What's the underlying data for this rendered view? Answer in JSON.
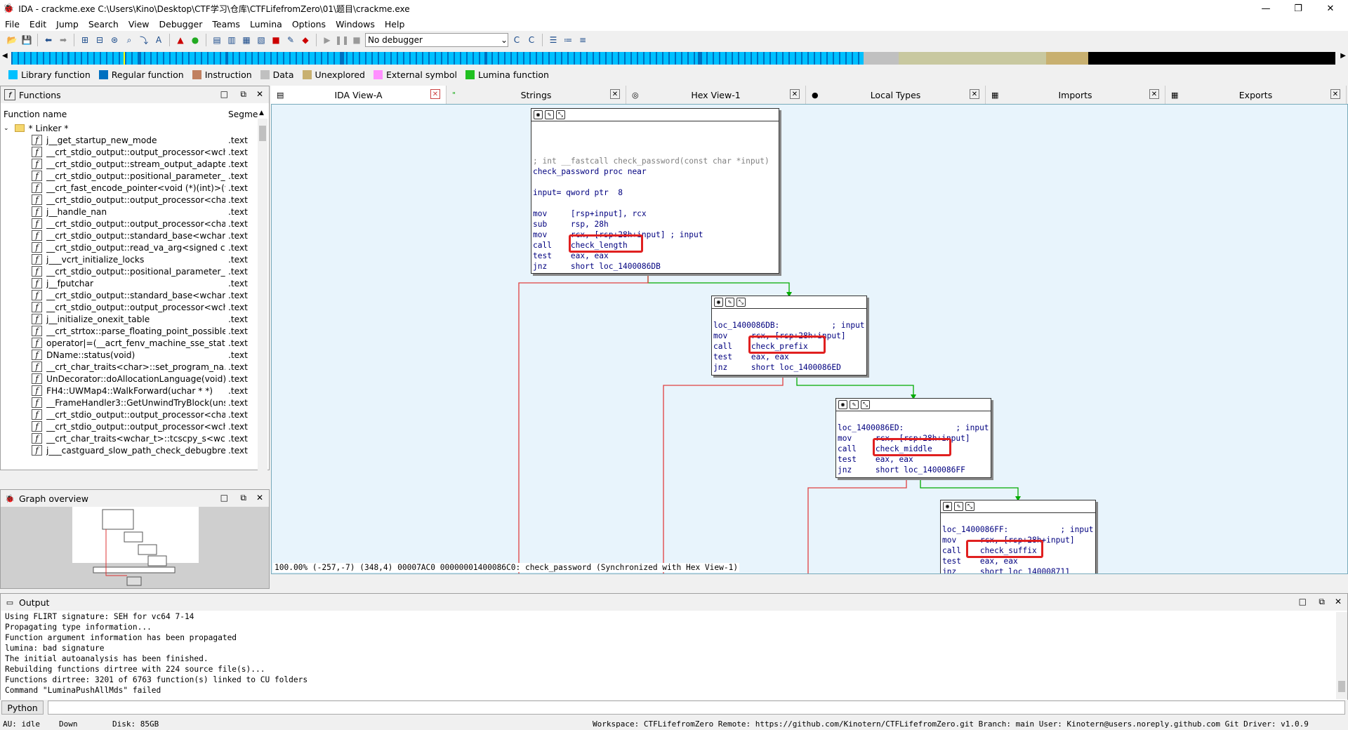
{
  "window": {
    "title": "IDA - crackme.exe C:\\Users\\Kino\\Desktop\\CTF学习\\仓库\\CTFLifefromZero\\01\\题目\\crackme.exe"
  },
  "menu": [
    "File",
    "Edit",
    "Jump",
    "Search",
    "View",
    "Debugger",
    "Teams",
    "Lumina",
    "Options",
    "Windows",
    "Help"
  ],
  "toolbar": {
    "debugger_select": "No debugger"
  },
  "legend": [
    {
      "label": "Library function",
      "color": "#00c0ff"
    },
    {
      "label": "Regular function",
      "color": "#0070c0"
    },
    {
      "label": "Instruction",
      "color": "#c08060"
    },
    {
      "label": "Data",
      "color": "#c0c0c0"
    },
    {
      "label": "Unexplored",
      "color": "#c8b070"
    },
    {
      "label": "External symbol",
      "color": "#ff90ff"
    },
    {
      "label": "Lumina function",
      "color": "#20c020"
    }
  ],
  "functions": {
    "title": "Functions",
    "col_name": "Function name",
    "col_seg": "Segme",
    "folder": "* Linker *",
    "rows": [
      {
        "name": "j__get_startup_new_mode",
        "seg": ".text"
      },
      {
        "name": "__crt_stdio_output::output_processor<wch...",
        "seg": ".text"
      },
      {
        "name": "__crt_stdio_output::stream_output_adapte...",
        "seg": ".text"
      },
      {
        "name": "__crt_stdio_output::positional_parameter_...",
        "seg": ".text"
      },
      {
        "name": "__crt_fast_encode_pointer<void (*)(int)>(v...",
        "seg": ".text"
      },
      {
        "name": "__crt_stdio_output::output_processor<cha...",
        "seg": ".text"
      },
      {
        "name": "j__handle_nan",
        "seg": ".text"
      },
      {
        "name": "__crt_stdio_output::output_processor<cha...",
        "seg": ".text"
      },
      {
        "name": "__crt_stdio_output::standard_base<wchar_...",
        "seg": ".text"
      },
      {
        "name": "__crt_stdio_output::read_va_arg<signed c...",
        "seg": ".text"
      },
      {
        "name": "j___vcrt_initialize_locks",
        "seg": ".text"
      },
      {
        "name": "__crt_stdio_output::positional_parameter_...",
        "seg": ".text"
      },
      {
        "name": "j__fputchar",
        "seg": ".text"
      },
      {
        "name": "__crt_stdio_output::standard_base<wchar_...",
        "seg": ".text"
      },
      {
        "name": "__crt_stdio_output::output_processor<wch...",
        "seg": ".text"
      },
      {
        "name": "j__initialize_onexit_table",
        "seg": ".text"
      },
      {
        "name": "__crt_strtox::parse_floating_point_possible...",
        "seg": ".text"
      },
      {
        "name": "operator|=(__acrt_fenv_machine_sse_statu...",
        "seg": ".text"
      },
      {
        "name": "DName::status(void)",
        "seg": ".text"
      },
      {
        "name": "__crt_char_traits<char>::set_program_na...",
        "seg": ".text"
      },
      {
        "name": "UnDecorator::doAllocationLanguage(void)",
        "seg": ".text"
      },
      {
        "name": "FH4::UWMap4::WalkForward(uchar * *)",
        "seg": ".text"
      },
      {
        "name": "__FrameHandler3::GetUnwindTryBlock(uns...",
        "seg": ".text"
      },
      {
        "name": "__crt_stdio_output::output_processor<cha...",
        "seg": ".text"
      },
      {
        "name": "__crt_stdio_output::output_processor<wch...",
        "seg": ".text"
      },
      {
        "name": "__crt_char_traits<wchar_t>::tcscpy_s<wcha...",
        "seg": ".text"
      },
      {
        "name": "j___castguard_slow_path_check_debugbre...",
        "seg": ".text"
      }
    ]
  },
  "tabs": [
    "IDA View-A",
    "Strings",
    "Hex View-1",
    "Local Types",
    "Imports",
    "Exports"
  ],
  "graph": {
    "node1": {
      "lines": [
        "; int __fastcall check_password(const char *input)",
        "check_password proc near",
        "",
        "input= qword ptr  8",
        "",
        "mov     [rsp+input], rcx",
        "sub     rsp, 28h",
        "mov     rcx, [rsp+28h+input] ; input",
        "call    check_length",
        "test    eax, eax",
        "jnz     short loc_1400086DB"
      ]
    },
    "node2": {
      "lines": [
        "loc_1400086DB:           ; input",
        "mov     rcx, [rsp+28h+input]",
        "call    check_prefix",
        "test    eax, eax",
        "jnz     short loc_1400086ED"
      ]
    },
    "node3": {
      "lines": [
        "loc_1400086ED:           ; input",
        "mov     rcx, [rsp+28h+input]",
        "call    check_middle",
        "test    eax, eax",
        "jnz     short loc_1400086FF"
      ]
    },
    "node4": {
      "lines": [
        "loc_1400086FF:           ; input",
        "mov     rcx, [rsp+28h+input]",
        "call    check_suffix",
        "test    eax, eax",
        "jnz     short loc_140008711"
      ]
    },
    "status": "100.00% (-257,-7) (348,4) 00007AC0 00000001400086C0: check_password (Synchronized with Hex View-1)"
  },
  "overview": {
    "title": "Graph overview"
  },
  "output": {
    "title": "Output",
    "lines": [
      "Using FLIRT signature: SEH for vc64 7-14",
      "Propagating type information...",
      "Function argument information has been propagated",
      "lumina: bad signature",
      "The initial autoanalysis has been finished.",
      "Rebuilding functions dirtree with 224 source file(s)...",
      "Functions dirtree: 3201 of 6763 function(s) linked to CU folders",
      "Command \"LuminaPushAllMds\" failed"
    ]
  },
  "python": {
    "label": "Python"
  },
  "statusbar": {
    "au": "AU:  idle",
    "dir": "Down",
    "disk": "Disk: 85GB",
    "workspace": "Workspace: CTFLifefromZero Remote: https://github.com/Kinotern/CTFLifefromZero.git Branch: main User: Kinotern@users.noreply.github.com Git Driver: v1.0.9"
  }
}
